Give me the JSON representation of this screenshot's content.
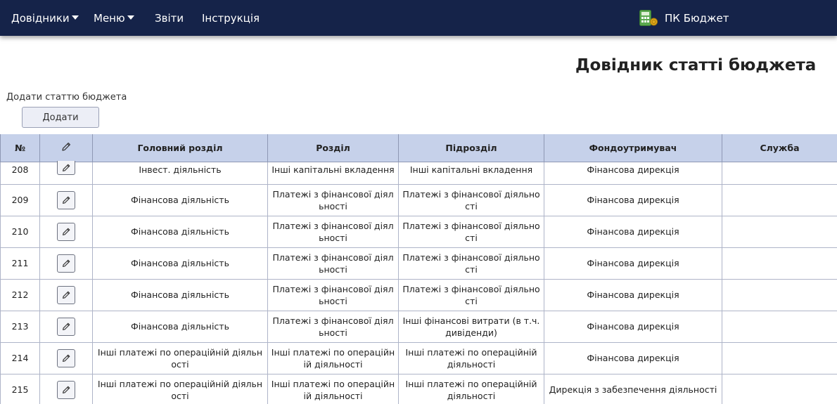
{
  "nav": {
    "dovidnyky": "Довідники",
    "menu": "Меню",
    "zvity": "Звіти",
    "instruktsiia": "Інструкція",
    "brand": "ПК Бюджет"
  },
  "page": {
    "title": "Довідник статті бюджета",
    "add_caption": "Додати статтю бюджета",
    "add_button": "Додати"
  },
  "table": {
    "headers": {
      "num": "№",
      "main_section": "Головний розділ",
      "section": "Розділ",
      "subsection": "Підрозділ",
      "fund_holder": "Фондоутримувач",
      "service": "Служба"
    },
    "rows": [
      {
        "num": "208",
        "main": "Інвест. діяльність",
        "section": "Інші капітальні вкладення",
        "sub": "Інші капітальні вкладення",
        "fund": "Фінансова дирекція",
        "service": ""
      },
      {
        "num": "209",
        "main": "Фінансова діяльність",
        "section": "Платежі з фінансової діяльності",
        "sub": "Платежі з фінансової діяльності",
        "fund": "Фінансова дирекція",
        "service": ""
      },
      {
        "num": "210",
        "main": "Фінансова діяльність",
        "section": "Платежі з фінансової діяльності",
        "sub": "Платежі з фінансової діяльності",
        "fund": "Фінансова дирекція",
        "service": ""
      },
      {
        "num": "211",
        "main": "Фінансова діяльність",
        "section": "Платежі з фінансової діяльності",
        "sub": "Платежі з фінансової діяльності",
        "fund": "Фінансова дирекція",
        "service": ""
      },
      {
        "num": "212",
        "main": "Фінансова діяльність",
        "section": "Платежі з фінансової діяльності",
        "sub": "Платежі з фінансової діяльності",
        "fund": "Фінансова дирекція",
        "service": ""
      },
      {
        "num": "213",
        "main": "Фінансова діяльність",
        "section": "Платежі з фінансової діяльності",
        "sub": "Інші фінансові витрати (в т.ч. дивіденди)",
        "fund": "Фінансова дирекція",
        "service": ""
      },
      {
        "num": "214",
        "main": "Інші платежі по операційній діяльності",
        "section": "Інші платежі по операційній діяльності",
        "sub": "Інші платежі по операційній діяльності",
        "fund": "Фінансова дирекція",
        "service": ""
      },
      {
        "num": "215",
        "main": "Інші платежі по операційній діяльності",
        "section": "Інші платежі по операційній діяльності",
        "sub": "Інші платежі по операційній діяльності",
        "fund": "Дирекція з забезпечення діяльності",
        "service": ""
      }
    ]
  },
  "icons": {
    "edit": "pencil-icon",
    "brand": "calculator-icon"
  },
  "colors": {
    "navbar": "#152349",
    "table_header": "#c6d1ea",
    "brand_icon_green": "#5aa84f",
    "brand_icon_coin": "#e0a91c"
  }
}
